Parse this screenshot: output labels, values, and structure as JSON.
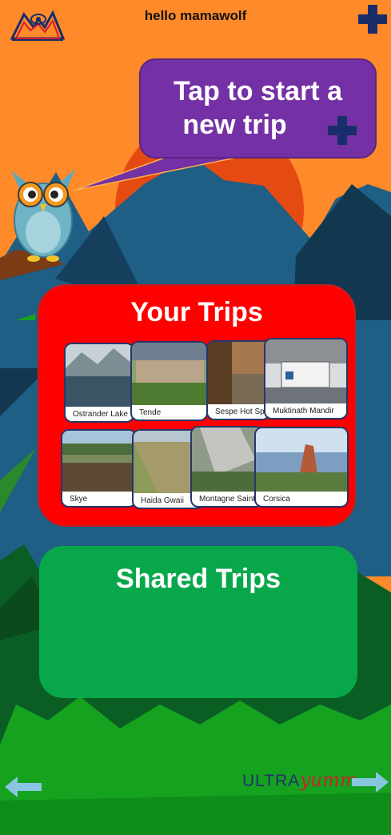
{
  "header": {
    "greeting": "hello mamawolf"
  },
  "callout": {
    "line1": "Tap to start a",
    "line2": "new trip"
  },
  "your_trips": {
    "title": "Your Trips",
    "trips": [
      {
        "name": "Ostrander Lake"
      },
      {
        "name": "Tende"
      },
      {
        "name": "Sespe Hot Spri"
      },
      {
        "name": "Muktinath Mandir"
      },
      {
        "name": "Skye"
      },
      {
        "name": "Haida Gwaii"
      },
      {
        "name": "Montagne Sainte"
      },
      {
        "name": "Corsica"
      }
    ]
  },
  "shared_trips": {
    "title": "Shared Trips"
  },
  "footer": {
    "brand_part1": "ULTRA",
    "brand_part2": "yumm"
  },
  "icons": {
    "logo": "mountain-eye-logo",
    "add": "plus-icon",
    "mascot": "owl-mascot",
    "back": "left-arrow-icon",
    "forward": "right-arrow-icon"
  },
  "colors": {
    "sky": "#ff8a2a",
    "sun": "#e44a12",
    "mountain_blue": "#1f5e85",
    "mountain_dark": "#12384f",
    "grass": "#0d8a19",
    "callout": "#7431a5",
    "your_trips_panel": "#ff0000",
    "shared_trips_panel": "#08a84a",
    "navy": "#1a2d6b",
    "arrow": "#88c6e0"
  }
}
